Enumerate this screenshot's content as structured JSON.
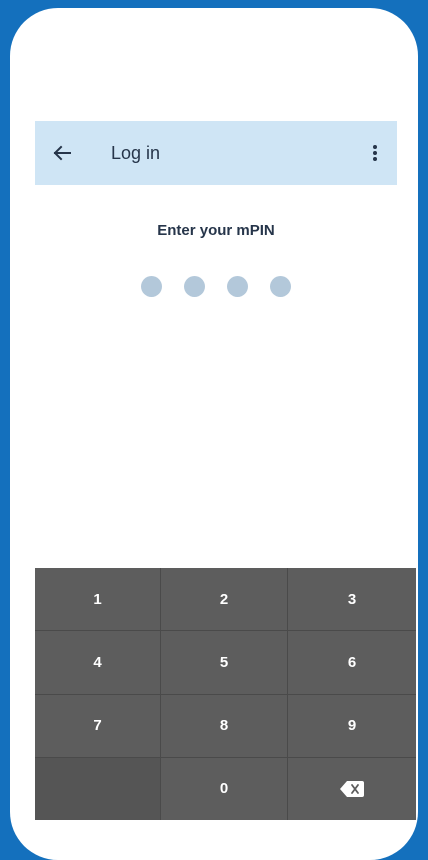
{
  "header": {
    "title": "Log in",
    "back_icon": "arrow-left-icon",
    "menu_icon": "more-vert-icon"
  },
  "pin": {
    "prompt": "Enter your mPIN",
    "length": 4,
    "filled": 0
  },
  "keypad": {
    "keys": [
      "1",
      "2",
      "3",
      "4",
      "5",
      "6",
      "7",
      "8",
      "9",
      "",
      "0"
    ],
    "backspace_icon": "backspace-icon"
  },
  "colors": {
    "frame": "#1470bd",
    "appbar": "#cfe5f5",
    "pin_dot": "#b3c8da",
    "keypad_bg": "#5d5d5d",
    "text_dark": "#26354a"
  }
}
